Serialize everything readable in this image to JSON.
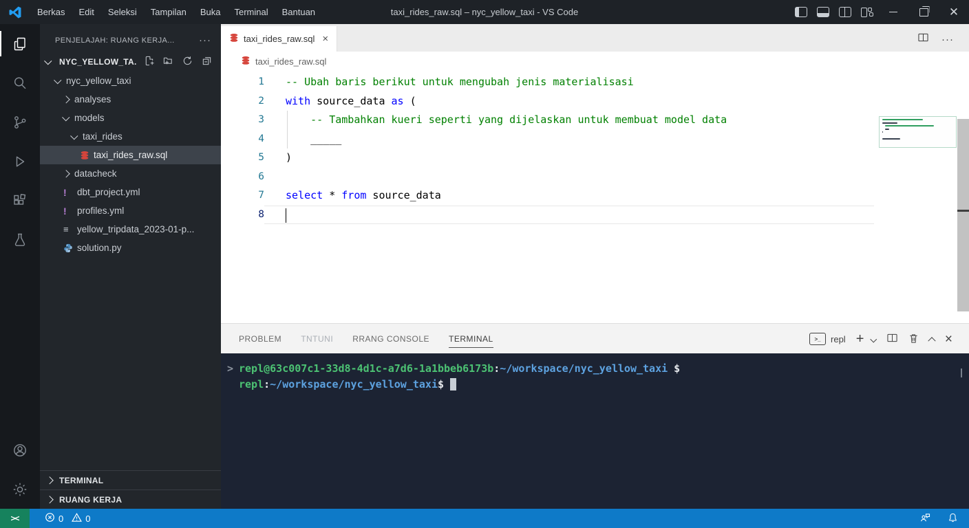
{
  "colors": {
    "accent_blue": "#0e7ac8",
    "remote_green": "#16825d",
    "terminal_bg": "#1c2333",
    "terminal_green": "#4cc273",
    "terminal_blue": "#5da2e0",
    "keyword_blue": "#0000ff",
    "comment_green": "#008000",
    "dbt_red": "#d6453c",
    "yaml_purple": "#b77fd4"
  },
  "titlebar": {
    "menus": [
      "Berkas",
      "Edit",
      "Seleksi",
      "Tampilan",
      "Buka",
      "Terminal",
      "Bantuan"
    ],
    "title": "taxi_rides_raw.sql – nyc_yellow_taxi - VS Code"
  },
  "activitybar": {
    "items": [
      {
        "name": "explorer",
        "active": true
      },
      {
        "name": "search"
      },
      {
        "name": "source-control"
      },
      {
        "name": "run-debug"
      },
      {
        "name": "extensions"
      },
      {
        "name": "testing"
      }
    ],
    "bottom": [
      {
        "name": "account"
      },
      {
        "name": "settings"
      }
    ]
  },
  "sidebar": {
    "header": "PENJELAJAH: RUANG KERJA...",
    "more_glyph": "···",
    "workspace": "NYC_YELLOW_TA.",
    "tree": [
      {
        "label": "nyc_yellow_taxi",
        "indent": 0,
        "chevron": "down"
      },
      {
        "label": "analyses",
        "indent": 1,
        "chevron": "right"
      },
      {
        "label": "models",
        "indent": 1,
        "chevron": "down"
      },
      {
        "label": "taxi_rides",
        "indent": 2,
        "chevron": "down"
      },
      {
        "label": "taxi_rides_raw.sql",
        "indent": 3,
        "icon": "db",
        "selected": true
      },
      {
        "label": "datacheck",
        "indent": 1,
        "chevron": "right"
      },
      {
        "label": "dbt_project.yml",
        "indent": 1,
        "icon": "excl"
      },
      {
        "label": "profiles.yml",
        "indent": 1,
        "icon": "excl"
      },
      {
        "label": "yellow_tripdata_2023-01-p...",
        "indent": 1,
        "icon": "lines"
      },
      {
        "label": "solution.py",
        "indent": 1,
        "icon": "py"
      }
    ],
    "bottom_sections": [
      {
        "label": "TERMINAL"
      },
      {
        "label": "RUANG KERJA"
      }
    ]
  },
  "editor": {
    "tab_label": "taxi_rides_raw.sql",
    "close_glyph": "×",
    "more_glyph": "···",
    "breadcrumb": "taxi_rides_raw.sql",
    "current_line": 8,
    "code_lines": [
      {
        "segments": [
          {
            "c": "com",
            "t": "-- Ubah baris berikut untuk mengubah jenis materialisasi"
          }
        ]
      },
      {
        "segments": [
          {
            "c": "kw",
            "t": "with"
          },
          {
            "c": "txt",
            "t": " source_data "
          },
          {
            "c": "kw",
            "t": "as"
          },
          {
            "c": "txt",
            "t": " ("
          }
        ]
      },
      {
        "segments": [
          {
            "c": "com",
            "t": "    -- Tambahkan kueri seperti yang dijelaskan untuk membuat model data"
          }
        ]
      },
      {
        "segments": [
          {
            "c": "txt",
            "t": "    _____"
          }
        ]
      },
      {
        "segments": [
          {
            "c": "txt",
            "t": ")"
          }
        ]
      },
      {
        "segments": []
      },
      {
        "segments": [
          {
            "c": "kw",
            "t": "select"
          },
          {
            "c": "txt",
            "t": " * "
          },
          {
            "c": "kw",
            "t": "from"
          },
          {
            "c": "txt",
            "t": " source_data"
          }
        ]
      },
      {
        "segments": []
      }
    ]
  },
  "panel": {
    "tabs": [
      {
        "label": "PROBLEM"
      },
      {
        "label": "TNTUNI",
        "faded": true
      },
      {
        "label": "RRANG CONSOLE"
      },
      {
        "label": "TERMINAL",
        "active": true
      }
    ],
    "terminal_icon_glyph": ">_",
    "terminal_label": "repl",
    "terminal_lines": [
      {
        "prefix": ">",
        "segments": [
          {
            "c": "g",
            "t": "repl@63c007c1-33d8-4d1c-a7d6-1a1bbeb6173b"
          },
          {
            "c": "w",
            "t": ":"
          },
          {
            "c": "b",
            "t": "~/workspace/nyc_yellow_taxi"
          },
          {
            "c": "w",
            "t": " $"
          }
        ],
        "cursor": false
      },
      {
        "prefix": "",
        "segments": [
          {
            "c": "g",
            "t": "repl"
          },
          {
            "c": "w",
            "t": ":"
          },
          {
            "c": "b",
            "t": "~/workspace/nyc_yellow_taxi"
          },
          {
            "c": "w",
            "t": "$"
          }
        ],
        "cursor": true
      }
    ]
  },
  "statusbar": {
    "remote_glyph": "><",
    "errors": "0",
    "warnings": "0"
  }
}
